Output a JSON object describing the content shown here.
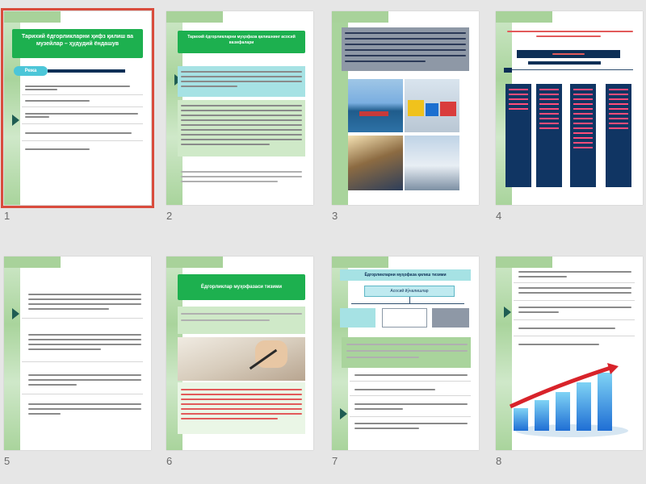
{
  "slides": [
    {
      "number": "1",
      "selected": true,
      "title": "Тарихий ёдгорликларни ҳифз қилиш ва музейлар – ҳудудий ёндашув",
      "tag": "Режа"
    },
    {
      "number": "2",
      "selected": false,
      "title": "Тарихий ёдгорликларни муҳофаза қилишнинг асосий вазифалари"
    },
    {
      "number": "3",
      "selected": false
    },
    {
      "number": "4",
      "selected": false
    },
    {
      "number": "5",
      "selected": false
    },
    {
      "number": "6",
      "selected": false,
      "title": "Ёдгорликлар муҳофазаси тизими"
    },
    {
      "number": "7",
      "selected": false,
      "title": "Ёдгорликларни муҳофаза қилиш тизими",
      "sub": "Асосий йўналишлар"
    },
    {
      "number": "8",
      "selected": false
    }
  ],
  "colors": {
    "selection": "#d94c3d",
    "title_green": "#1db04f",
    "navy": "#0d2f56",
    "cyan": "#4cc6d8",
    "strip_green": "#a9d49c"
  }
}
